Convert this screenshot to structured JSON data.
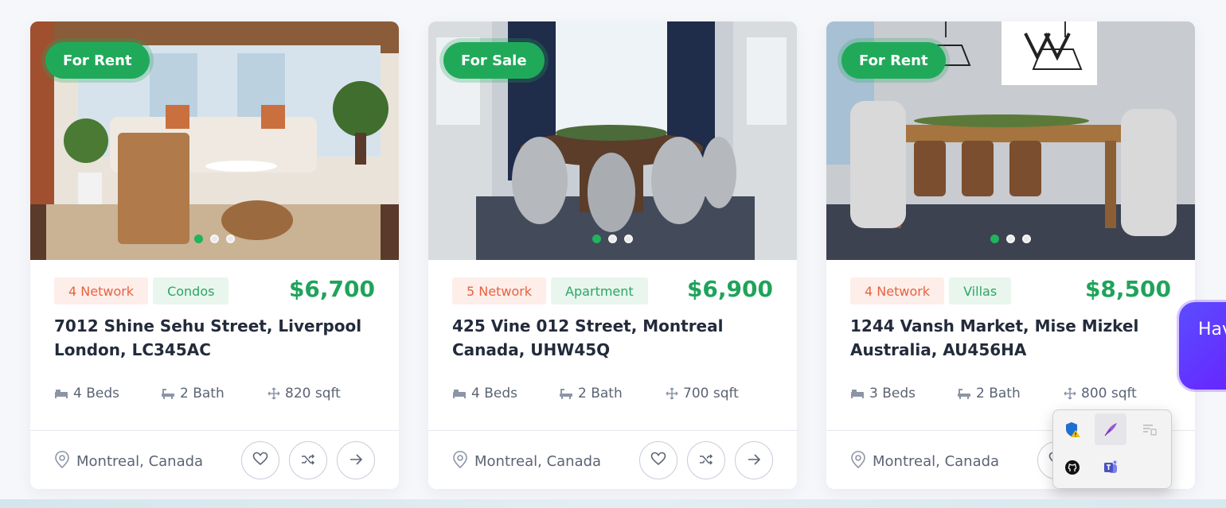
{
  "listings": [
    {
      "status": "For Rent",
      "network": "4 Network",
      "type": "Condos",
      "price": "$6,700",
      "address": "7012 Shine Sehu Street, Liverpool London, LC345AC",
      "beds": "4 Beds",
      "bath": "2 Bath",
      "area": "820 sqft",
      "location": "Montreal, Canada",
      "slide": {
        "current": 1,
        "total": 3
      }
    },
    {
      "status": "For Sale",
      "network": "5 Network",
      "type": "Apartment",
      "price": "$6,900",
      "address": "425 Vine 012 Street, Montreal Canada, UHW45Q",
      "beds": "4 Beds",
      "bath": "2 Bath",
      "area": "700 sqft",
      "location": "Montreal, Canada",
      "slide": {
        "current": 1,
        "total": 3
      }
    },
    {
      "status": "For Rent",
      "network": "4 Network",
      "type": "Villas",
      "price": "$8,500",
      "address": "1244 Vansh Market, Mise Mizkel Australia, AU456HA",
      "beds": "3 Beds",
      "bath": "2 Bath",
      "area": "800 sqft",
      "location": "Montreal, Canada",
      "slide": {
        "current": 1,
        "total": 3
      }
    }
  ],
  "chat_widget": {
    "label": "Hav"
  },
  "icons": {
    "bed": "bed-icon",
    "bath": "bath-icon",
    "area": "area-icon",
    "location": "map-pin-icon",
    "favorite": "heart-icon",
    "compare": "shuffle-icon",
    "details": "arrow-right-icon"
  },
  "tray_icons": [
    "windows-security-icon",
    "feather-pen-icon",
    "speech-icon",
    "github-icon",
    "teams-icon"
  ],
  "colors": {
    "status": "#21a95a",
    "price": "#20a35b",
    "network_tag_bg": "#fdeeea",
    "network_tag_text": "#e8623f",
    "type_tag_bg": "#e8f6ee",
    "type_tag_text": "#2ea564",
    "chat_widget": "#5b4dff"
  }
}
